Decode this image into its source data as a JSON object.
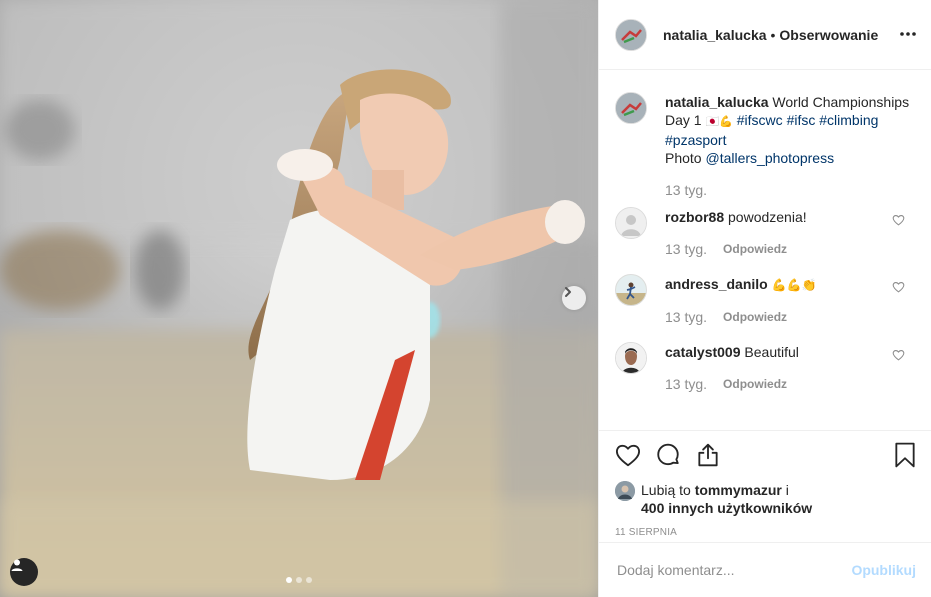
{
  "post": {
    "username": "natalia_kalucka",
    "separator": "•",
    "follow_label": "Obserwowanie",
    "more_icon": "ellipsis-icon",
    "carousel": {
      "total_slides": 3,
      "active_slide": 1
    }
  },
  "caption": {
    "username": "natalia_kalucka",
    "text_1": "World Championships Day 1 ",
    "emoji": "🇯🇵💪",
    "tags": [
      "#ifscwc",
      "#ifsc",
      "#climbing",
      "#pzasport"
    ],
    "photo_prefix": "Photo ",
    "photo_credit": "@tallers_photopress",
    "time": "13 tyg."
  },
  "comments": [
    {
      "username": "rozbor88",
      "text": "powodzenia!",
      "time": "13 tyg.",
      "reply": "Odpowiedz",
      "avatar": "default"
    },
    {
      "username": "andress_danilo",
      "text": "💪💪👏",
      "time": "13 tyg.",
      "reply": "Odpowiedz",
      "avatar": "runner"
    },
    {
      "username": "catalyst009",
      "text": "Beautiful",
      "time": "13 tyg.",
      "reply": "Odpowiedz",
      "avatar": "face"
    }
  ],
  "likes": {
    "prefix": "Lubią to ",
    "user": "tommymazur",
    "mid": " i",
    "others": "400 innych użytkowników"
  },
  "date": "11 sierpnia",
  "add_comment": {
    "placeholder": "Dodaj komentarz...",
    "publish": "Opublikuj"
  },
  "colors": {
    "link": "#003569",
    "muted": "#8e8e8e",
    "text": "#262626",
    "publish_disabled": "#b3dbff"
  }
}
